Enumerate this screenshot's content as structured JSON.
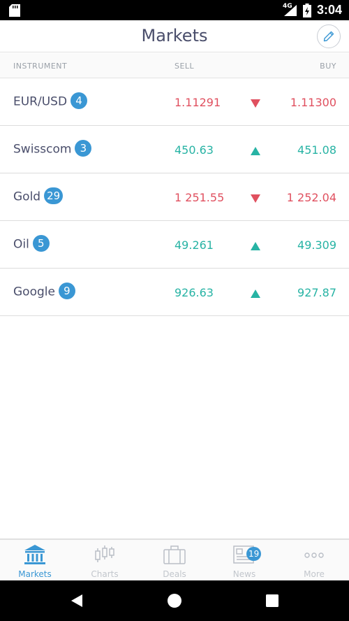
{
  "status_bar": {
    "network": "4G",
    "time": "3:04"
  },
  "header": {
    "title": "Markets",
    "edit_icon": "pencil-icon"
  },
  "columns": {
    "instrument": "INSTRUMENT",
    "sell": "SELL",
    "buy": "BUY"
  },
  "instruments": [
    {
      "name": "EUR/USD",
      "badge": "4",
      "sell": "1.11291",
      "buy": "1.11300",
      "trend": "down"
    },
    {
      "name": "Swisscom",
      "badge": "3",
      "sell": "450.63",
      "buy": "451.08",
      "trend": "up"
    },
    {
      "name": "Gold",
      "badge": "29",
      "sell": "1 251.55",
      "buy": "1 252.04",
      "trend": "down"
    },
    {
      "name": "Oil",
      "badge": "5",
      "sell": "49.261",
      "buy": "49.309",
      "trend": "up"
    },
    {
      "name": "Google",
      "badge": "9",
      "sell": "926.63",
      "buy": "927.87",
      "trend": "up"
    }
  ],
  "colors": {
    "down": "#e0505f",
    "up": "#27b3a4",
    "accent": "#3a97d4",
    "title": "#4a4e6b"
  },
  "bottom_nav": {
    "items": [
      {
        "label": "Markets",
        "icon": "bank-icon",
        "active": true
      },
      {
        "label": "Charts",
        "icon": "candlestick-icon",
        "active": false
      },
      {
        "label": "Deals",
        "icon": "briefcase-icon",
        "active": false
      },
      {
        "label": "News",
        "icon": "newspaper-icon",
        "active": false,
        "badge": "19"
      },
      {
        "label": "More",
        "icon": "more-dots-icon",
        "active": false
      }
    ]
  }
}
